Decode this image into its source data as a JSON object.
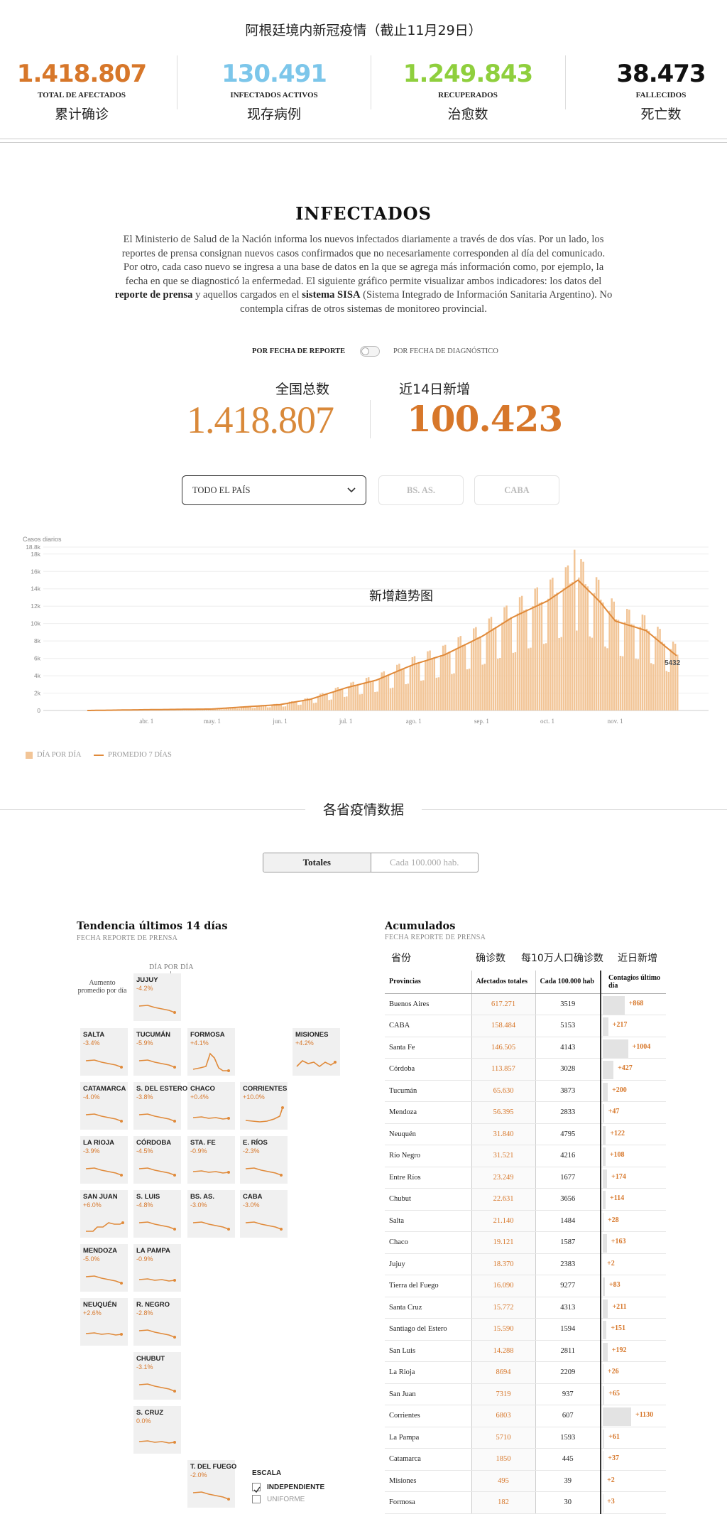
{
  "header": {
    "title": "阿根廷境内新冠疫情（截止11月29日）",
    "stats": [
      {
        "value": "1.418.807",
        "label": "TOTAL DE AFECTADOS",
        "cn": "累计确诊",
        "color": "#d7772a"
      },
      {
        "value": "130.491",
        "label": "INFECTADOS ACTIVOS",
        "cn": "现存病例",
        "color": "#7cc6ea"
      },
      {
        "value": "1.249.843",
        "label": "RECUPERADOS",
        "cn": "治愈数",
        "color": "#8fcf3d"
      },
      {
        "value": "38.473",
        "label": "FALLECIDOS",
        "cn": "死亡数",
        "color": "#111111"
      }
    ]
  },
  "infectados": {
    "title": "INFECTADOS",
    "body_1": "El Ministerio de Salud de la Nación informa los nuevos infectados diariamente a través de dos vías. Por un lado, los reportes de prensa consignan nuevos casos confirmados que no necesariamente corresponden al día del comunicado. Por otro, cada caso nuevo se ingresa a una base de datos en la que se agrega más información como, por ejemplo, la fecha en que se diagnosticó la enfermedad. El siguiente gráfico permite visualizar ambos indicadores: los datos del ",
    "body_b1": "reporte de prensa",
    "body_2": " y aquellos cargados en el ",
    "body_b2": "sistema SISA",
    "body_3": " (Sistema Integrado de Información Sanitaria Argentino). No contempla cifras de otros sistemas de monitoreo provincial.",
    "toggle_left": "POR FECHA DE REPORTE",
    "toggle_right": "POR FECHA DE DIAGNÓSTICO",
    "total_cn": "全国总数",
    "total_value": "1.418.807",
    "recent_cn": "近14日新增",
    "recent_value": "100.423",
    "region_select": "TODO EL PAÍS",
    "region_btn_1": "BS. AS.",
    "region_btn_2": "CABA"
  },
  "chart_data": {
    "type": "bar",
    "title": "新增趋势图",
    "ylabel": "Casos diarios",
    "y_ticks": [
      "0",
      "2k",
      "4k",
      "6k",
      "8k",
      "10k",
      "12k",
      "14k",
      "16k",
      "18k",
      "18.8k"
    ],
    "ylim": [
      0,
      18800
    ],
    "x_ticks": [
      "abr. 1",
      "may. 1",
      "jun. 1",
      "jul. 1",
      "ago. 1",
      "sep. 1",
      "oct. 1",
      "nov. 1"
    ],
    "last_value_label": "5432",
    "series": [
      {
        "name": "DÍA POR DÍA",
        "kind": "bar",
        "color": "#f2c597"
      },
      {
        "name": "PROMEDIO 7 DÍAS",
        "kind": "line",
        "color": "#e08a3a"
      }
    ],
    "weekly_avg_points": [
      {
        "x": "Mar 5",
        "y": 0
      },
      {
        "x": "abr. 1",
        "y": 90
      },
      {
        "x": "may. 1",
        "y": 170
      },
      {
        "x": "jun. 1",
        "y": 680
      },
      {
        "x": "jun. 15",
        "y": 1300
      },
      {
        "x": "jul. 1",
        "y": 2600
      },
      {
        "x": "jul. 15",
        "y": 3500
      },
      {
        "x": "ago. 1",
        "y": 5300
      },
      {
        "x": "ago. 15",
        "y": 6400
      },
      {
        "x": "sep. 1",
        "y": 8500
      },
      {
        "x": "sep. 15",
        "y": 10700
      },
      {
        "x": "oct. 1",
        "y": 12600
      },
      {
        "x": "oct. 15",
        "y": 15000
      },
      {
        "x": "oct. 25",
        "y": 12500
      },
      {
        "x": "nov. 1",
        "y": 10300
      },
      {
        "x": "nov. 15",
        "y": 9200
      },
      {
        "x": "nov. 29",
        "y": 6300
      }
    ],
    "legend": "bottom-left"
  },
  "provinces_section": {
    "title": "各省疫情数据",
    "seg_on": "Totales",
    "seg_off": "Cada 100.000 hab."
  },
  "tendencia": {
    "title": "Tendencia últimos 14 días",
    "subtitle": "FECHA REPORTE DE PRENSA",
    "dia_label": "DÍA POR DÍA",
    "avg_label": "Aumento promedio por día",
    "scale_title": "ESCALA",
    "scale_opt1": "INDEPENDIENTE",
    "scale_opt2": "UNIFORME",
    "tiles": [
      {
        "name": "JUJUY",
        "pct": "-4.2%",
        "shape": "down"
      },
      {
        "name": "SALTA",
        "pct": "-3.4%",
        "shape": "down"
      },
      {
        "name": "TUCUMÁN",
        "pct": "-5.9%",
        "shape": "down"
      },
      {
        "name": "FORMOSA",
        "pct": "+4.1%",
        "shape": "spike"
      },
      {
        "name": "MISIONES",
        "pct": "+4.2%",
        "shape": "wavy"
      },
      {
        "name": "CATAMARCA",
        "pct": "-4.0%",
        "shape": "down"
      },
      {
        "name": "S. DEL ESTERO",
        "pct": "-3.8%",
        "shape": "down"
      },
      {
        "name": "CHACO",
        "pct": "+0.4%",
        "shape": "flat"
      },
      {
        "name": "CORRIENTES",
        "pct": "+10.0%",
        "shape": "up"
      },
      {
        "name": "LA RIOJA",
        "pct": "-3.9%",
        "shape": "down"
      },
      {
        "name": "CÓRDOBA",
        "pct": "-4.5%",
        "shape": "down"
      },
      {
        "name": "STA. FE",
        "pct": "-0.9%",
        "shape": "flat"
      },
      {
        "name": "E. RÍOS",
        "pct": "-2.3%",
        "shape": "down"
      },
      {
        "name": "SAN JUAN",
        "pct": "+6.0%",
        "shape": "up2"
      },
      {
        "name": "S. LUIS",
        "pct": "-4.8%",
        "shape": "down"
      },
      {
        "name": "BS. AS.",
        "pct": "-3.0%",
        "shape": "down"
      },
      {
        "name": "CABA",
        "pct": "-3.0%",
        "shape": "down"
      },
      {
        "name": "MENDOZA",
        "pct": "-5.0%",
        "shape": "down"
      },
      {
        "name": "LA PAMPA",
        "pct": "-0.9%",
        "shape": "flat"
      },
      {
        "name": "NEUQUÉN",
        "pct": "+2.6%",
        "shape": "flat"
      },
      {
        "name": "R. NEGRO",
        "pct": "-2.8%",
        "shape": "down"
      },
      {
        "name": "CHUBUT",
        "pct": "-3.1%",
        "shape": "down"
      },
      {
        "name": "S. CRUZ",
        "pct": "0.0%",
        "shape": "flat"
      },
      {
        "name": "T. DEL FUEGO",
        "pct": "-2.0%",
        "shape": "down"
      }
    ]
  },
  "acumulados": {
    "title": "Acumulados",
    "subtitle": "FECHA REPORTE DE PRENSA",
    "cn_headers": [
      "省份",
      "确诊数",
      "每10万人口确诊数",
      "近日新增"
    ],
    "headers": [
      "Provincias",
      "Afectados totales",
      "Cada 100.000 hab",
      "Contagios último día"
    ],
    "rows": [
      {
        "prov": "Buenos Aires",
        "total": "617.271",
        "per100k": "3519",
        "new": "+868",
        "n": 868
      },
      {
        "prov": "CABA",
        "total": "158.484",
        "per100k": "5153",
        "new": "+217",
        "n": 217
      },
      {
        "prov": "Santa Fe",
        "total": "146.505",
        "per100k": "4143",
        "new": "+1004",
        "n": 1004
      },
      {
        "prov": "Córdoba",
        "total": "113.857",
        "per100k": "3028",
        "new": "+427",
        "n": 427
      },
      {
        "prov": "Tucumán",
        "total": "65.630",
        "per100k": "3873",
        "new": "+200",
        "n": 200
      },
      {
        "prov": "Mendoza",
        "total": "56.395",
        "per100k": "2833",
        "new": "+47",
        "n": 47
      },
      {
        "prov": "Neuquén",
        "total": "31.840",
        "per100k": "4795",
        "new": "+122",
        "n": 122
      },
      {
        "prov": "Río Negro",
        "total": "31.521",
        "per100k": "4216",
        "new": "+108",
        "n": 108
      },
      {
        "prov": "Entre Ríos",
        "total": "23.249",
        "per100k": "1677",
        "new": "+174",
        "n": 174
      },
      {
        "prov": "Chubut",
        "total": "22.631",
        "per100k": "3656",
        "new": "+114",
        "n": 114
      },
      {
        "prov": "Salta",
        "total": "21.140",
        "per100k": "1484",
        "new": "+28",
        "n": 28
      },
      {
        "prov": "Chaco",
        "total": "19.121",
        "per100k": "1587",
        "new": "+163",
        "n": 163
      },
      {
        "prov": "Jujuy",
        "total": "18.370",
        "per100k": "2383",
        "new": "+2",
        "n": 2
      },
      {
        "prov": "Tierra del Fuego",
        "total": "16.090",
        "per100k": "9277",
        "new": "+83",
        "n": 83
      },
      {
        "prov": "Santa Cruz",
        "total": "15.772",
        "per100k": "4313",
        "new": "+211",
        "n": 211
      },
      {
        "prov": "Santiago del Estero",
        "total": "15.590",
        "per100k": "1594",
        "new": "+151",
        "n": 151
      },
      {
        "prov": "San Luis",
        "total": "14.288",
        "per100k": "2811",
        "new": "+192",
        "n": 192
      },
      {
        "prov": "La Rioja",
        "total": "8694",
        "per100k": "2209",
        "new": "+26",
        "n": 26
      },
      {
        "prov": "San Juan",
        "total": "7319",
        "per100k": "937",
        "new": "+65",
        "n": 65
      },
      {
        "prov": "Corrientes",
        "total": "6803",
        "per100k": "607",
        "new": "+1130",
        "n": 1130
      },
      {
        "prov": "La Pampa",
        "total": "5710",
        "per100k": "1593",
        "new": "+61",
        "n": 61
      },
      {
        "prov": "Catamarca",
        "total": "1850",
        "per100k": "445",
        "new": "+37",
        "n": 37
      },
      {
        "prov": "Misiones",
        "total": "495",
        "per100k": "39",
        "new": "+2",
        "n": 2
      },
      {
        "prov": "Formosa",
        "total": "182",
        "per100k": "30",
        "new": "+3",
        "n": 3
      }
    ]
  }
}
